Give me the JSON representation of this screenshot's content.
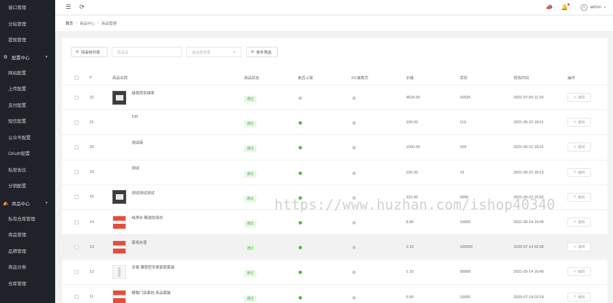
{
  "sidebar": {
    "items_top": [
      "接口管理",
      "分站管理",
      "提现管理"
    ],
    "group_config": {
      "label": "配置中心",
      "icon": "gear-icon"
    },
    "config_items": [
      "网站配置",
      "上传配置",
      "支付配置",
      "短信配置",
      "公众号配置",
      "OAuth配置",
      "私密协议",
      "分销配置"
    ],
    "group_goods": {
      "label": "商品中心",
      "icon": "bag-icon"
    },
    "goods_items": [
      "私有仓库管理",
      "商品管理",
      "品牌管理",
      "商品分类",
      "仓库管理"
    ]
  },
  "header": {
    "user": "admin"
  },
  "breadcrumb": [
    "首页",
    "商品中心",
    "商品管理"
  ],
  "toolbar": {
    "refresh_label": "待审核列表",
    "search_placeholder": "商品名",
    "select_placeholder": "请选择类型",
    "filter_label": "条件筛选"
  },
  "table": {
    "headers": [
      "#",
      "商品名称",
      "商品状态",
      "是否上架",
      "PC端首页",
      "价格",
      "库存",
      "修改时间",
      "操作"
    ],
    "rows": [
      {
        "id": "22",
        "name": "绿茶西安绿茶",
        "thumb": "dark",
        "status": "通过",
        "onsale": false,
        "pc": false,
        "price": "4524.00",
        "stock": "16535",
        "time": "2021-07-09 11:24",
        "action": "编辑"
      },
      {
        "id": "21",
        "name": "100",
        "thumb": "empty",
        "status": "通过",
        "onsale": true,
        "pc": false,
        "price": "100.00",
        "stock": "113",
        "time": "2021-05-22 18:21",
        "action": "编辑"
      },
      {
        "id": "20",
        "name": "测试商",
        "thumb": "empty",
        "status": "通过",
        "onsale": true,
        "pc": false,
        "price": "1000.00",
        "stock": "159",
        "time": "2021-05-22 18:21",
        "action": "编辑"
      },
      {
        "id": "19",
        "name": "测试",
        "thumb": "empty",
        "status": "通过",
        "onsale": true,
        "pc": false,
        "price": "100.00",
        "stock": "23",
        "time": "2021-05-22 18:13",
        "action": "编辑"
      },
      {
        "id": "16",
        "name": "测试测试测试",
        "thumb": "dark",
        "status": "通过",
        "onsale": true,
        "pc": false,
        "price": "222.00",
        "stock": "9090",
        "time": "2021-05-22 15:32",
        "action": "编辑"
      },
      {
        "id": "14",
        "name": "纯净水 精选饮用水",
        "thumb": "red",
        "status": "通过",
        "onsale": true,
        "pc": false,
        "price": "8.80",
        "stock": "10000",
        "time": "2021-05-14 16:49",
        "action": "编辑"
      },
      {
        "id": "13",
        "name": "家用水壶",
        "thumb": "red",
        "status": "通过",
        "onsale": true,
        "pc": false,
        "price": "2.10",
        "stock": "100000",
        "time": "2020-07-14 02:28",
        "action": "编辑"
      },
      {
        "id": "12",
        "name": "牙膏 薄荷型牙膏家庭套装",
        "thumb": "pale",
        "status": "通过",
        "onsale": true,
        "pc": false,
        "price": "1.10",
        "stock": "99999",
        "time": "2021-05-14 16:49",
        "action": "编辑"
      },
      {
        "id": "11",
        "name": "精致门店家纺 床品套装",
        "thumb": "red",
        "status": "通过",
        "onsale": true,
        "pc": false,
        "price": "0.50",
        "stock": "10000",
        "time": "2020-07-14 02:18",
        "action": "编辑"
      }
    ]
  },
  "watermark": "https://www.huzhan.com/ishop40340",
  "colors": {
    "sidebar": "#20222a",
    "success": "#4cbb44",
    "badge_bg": "#eaf8e7"
  }
}
